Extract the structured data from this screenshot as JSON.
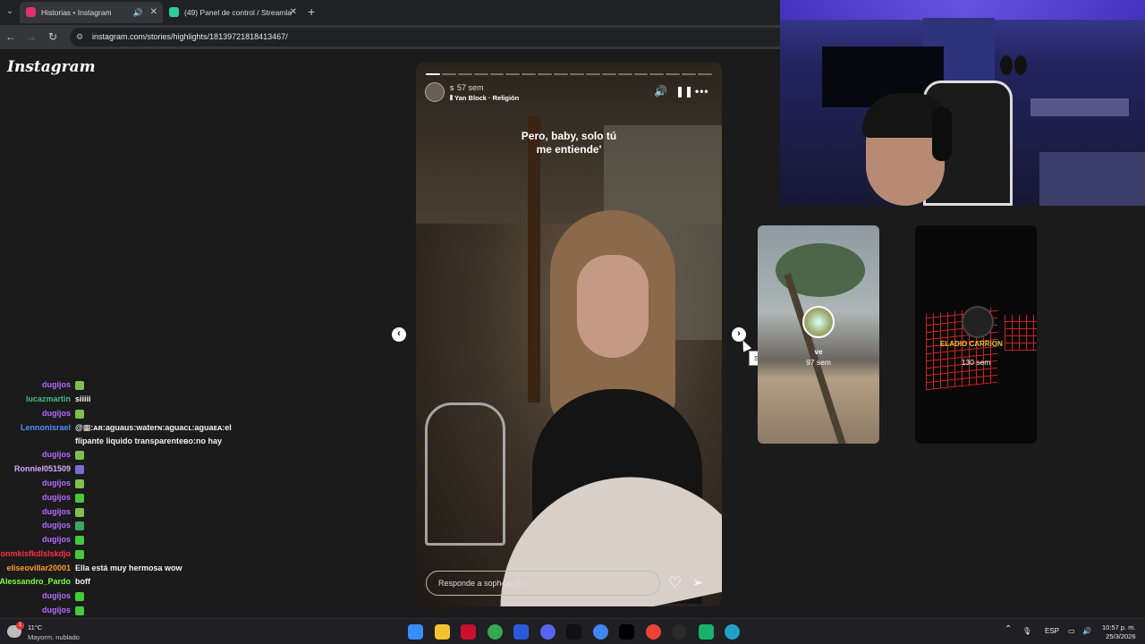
{
  "browser": {
    "tabs": [
      {
        "title": "Historias • Instagram",
        "active": true,
        "favicon_color": "#e1306c"
      },
      {
        "title": "(49) Panel de control / Streamla",
        "active": false,
        "favicon_color": "#2ecc9a"
      }
    ],
    "url": "instagram.com/stories/highlights/18139721818413467/"
  },
  "instagram": {
    "logo": "Instagram",
    "story": {
      "username": "s",
      "time": "57 sem",
      "music": "Yan Block · Religión",
      "caption_line1": "Pero, baby, solo tú",
      "caption_line2": "me entiende'",
      "reply_placeholder": "Responde a soph4acym...",
      "segments_total": 18,
      "segments_done": 1
    },
    "next_tooltip": "Siguiente",
    "previews": [
      {
        "name": "ve",
        "time": "97 sem"
      },
      {
        "name": "",
        "time": "130 sem",
        "title": "ELADIO CARRION"
      }
    ]
  },
  "chat": [
    {
      "user": "dugijos",
      "color": "#b36bff",
      "text": "",
      "emote": "#7fbf4f"
    },
    {
      "user": "lucazmartin",
      "color": "#3fbf7f",
      "text": "siiiii",
      "emote": ""
    },
    {
      "user": "dugijos",
      "color": "#b36bff",
      "text": "",
      "emote": "#7fbf4f"
    },
    {
      "user": "Lennonisrael",
      "color": "#4f8fff",
      "text": "@▦:ᴀʀ:aguaus:waterɴ:aguacʟ:aguaᴇᴀ:el",
      "emote": ""
    },
    {
      "user": "",
      "color": "#fff",
      "text": "flipante liquido transparenteʙᴏ:no hay",
      "emote": ""
    },
    {
      "user": "dugijos",
      "color": "#b36bff",
      "text": "",
      "emote": "#7fbf4f"
    },
    {
      "user": "Ronniel051509",
      "color": "#d8a8ff",
      "text": "",
      "emote": "#7a6cd0"
    },
    {
      "user": "dugijos",
      "color": "#b36bff",
      "text": "",
      "emote": "#7fbf4f"
    },
    {
      "user": "dugijos",
      "color": "#b36bff",
      "text": "",
      "emote": "#46c93a"
    },
    {
      "user": "dugijos",
      "color": "#b36bff",
      "text": "",
      "emote": "#7fbf4f"
    },
    {
      "user": "dugijos",
      "color": "#b36bff",
      "text": "",
      "emote": "#3aa85a"
    },
    {
      "user": "dugijos",
      "color": "#b36bff",
      "text": "",
      "emote": "#46c93a"
    },
    {
      "user": "onmkisfkdlslskdjo",
      "color": "#ff3040",
      "text": "",
      "emote": "#46c93a"
    },
    {
      "user": "eliseovillar20001",
      "color": "#ff9a2e",
      "text": "Ella está muy hermosa wow",
      "emote": ""
    },
    {
      "user": "Alessandro_Pardo",
      "color": "#7fff3a",
      "text": "boff",
      "emote": ""
    },
    {
      "user": "dugijos",
      "color": "#b36bff",
      "text": "",
      "emote": "#46c93a"
    },
    {
      "user": "dugijos",
      "color": "#b36bff",
      "text": "",
      "emote": "#46c93a"
    }
  ],
  "taskbar": {
    "weather_temp": "11°C",
    "weather_desc": "Mayorm. nublado",
    "weather_badge": "1",
    "language": "ESP",
    "time": "10:57 p. m.",
    "date": "25/3/2026",
    "apps": [
      "windows-start",
      "file-explorer",
      "acrobat",
      "chrome",
      "app-blue",
      "discord",
      "capcut",
      "chrome-2",
      "tiktok",
      "chrome-3",
      "game-app",
      "app-green",
      "edge"
    ]
  }
}
